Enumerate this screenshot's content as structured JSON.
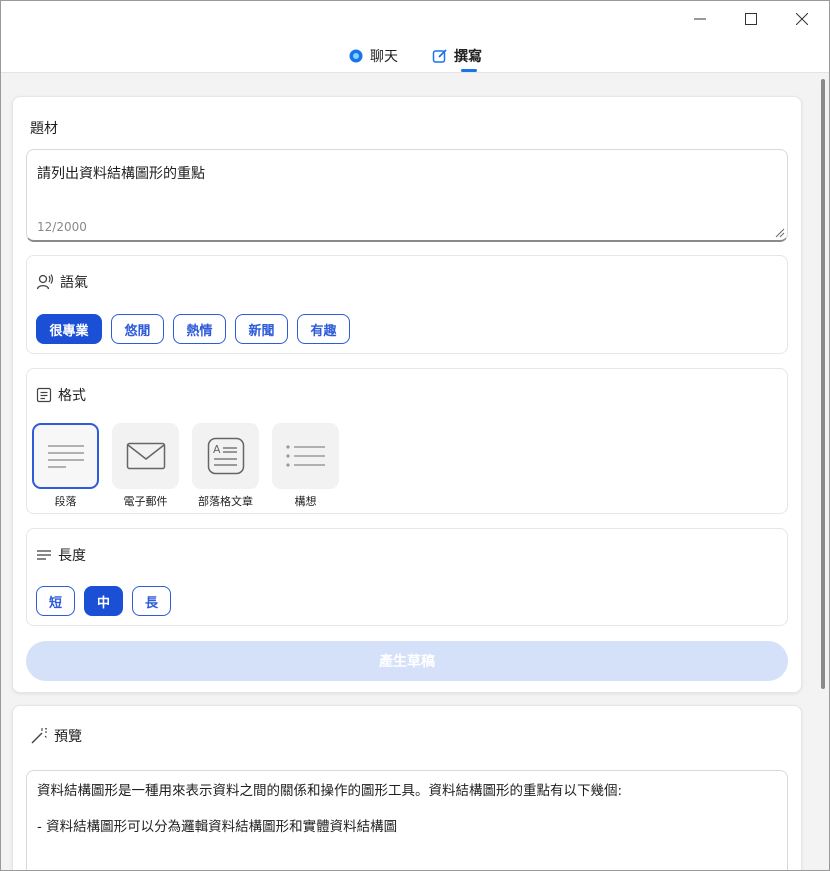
{
  "window": {
    "controls": [
      "minimize-icon",
      "maximize-icon",
      "close-icon"
    ]
  },
  "tabs": [
    {
      "label": "聊天",
      "icon": "chat-bubble-icon",
      "active": false
    },
    {
      "label": "撰寫",
      "icon": "compose-icon",
      "active": true
    }
  ],
  "topic": {
    "label": "題材",
    "value": "請列出資料結構圖形的重點",
    "counter": "12/2000"
  },
  "tone": {
    "label": "語氣",
    "icon": "voice-icon",
    "options": [
      "很專業",
      "悠閒",
      "熱情",
      "新聞",
      "有趣"
    ],
    "selected": "很專業"
  },
  "format": {
    "label": "格式",
    "icon": "format-icon",
    "options": [
      "段落",
      "電子郵件",
      "部落格文章",
      "構想"
    ],
    "selected": "段落"
  },
  "length": {
    "label": "長度",
    "icon": "length-icon",
    "options": [
      "短",
      "中",
      "長"
    ],
    "selected": "中"
  },
  "generate_label": "產生草稿",
  "preview": {
    "label": "預覽",
    "icon": "magic-wand-icon",
    "lines": [
      "資料結構圖形是一種用來表示資料之間的關係和操作的圖形工具。資料結構圖形的重點有以下幾個:",
      "- 資料結構圖形可以分為邏輯資料結構圖形和實體資料結構圖"
    ]
  },
  "colors": {
    "accent": "#1a4fd6",
    "generate_disabled": "#d5e1f9"
  }
}
